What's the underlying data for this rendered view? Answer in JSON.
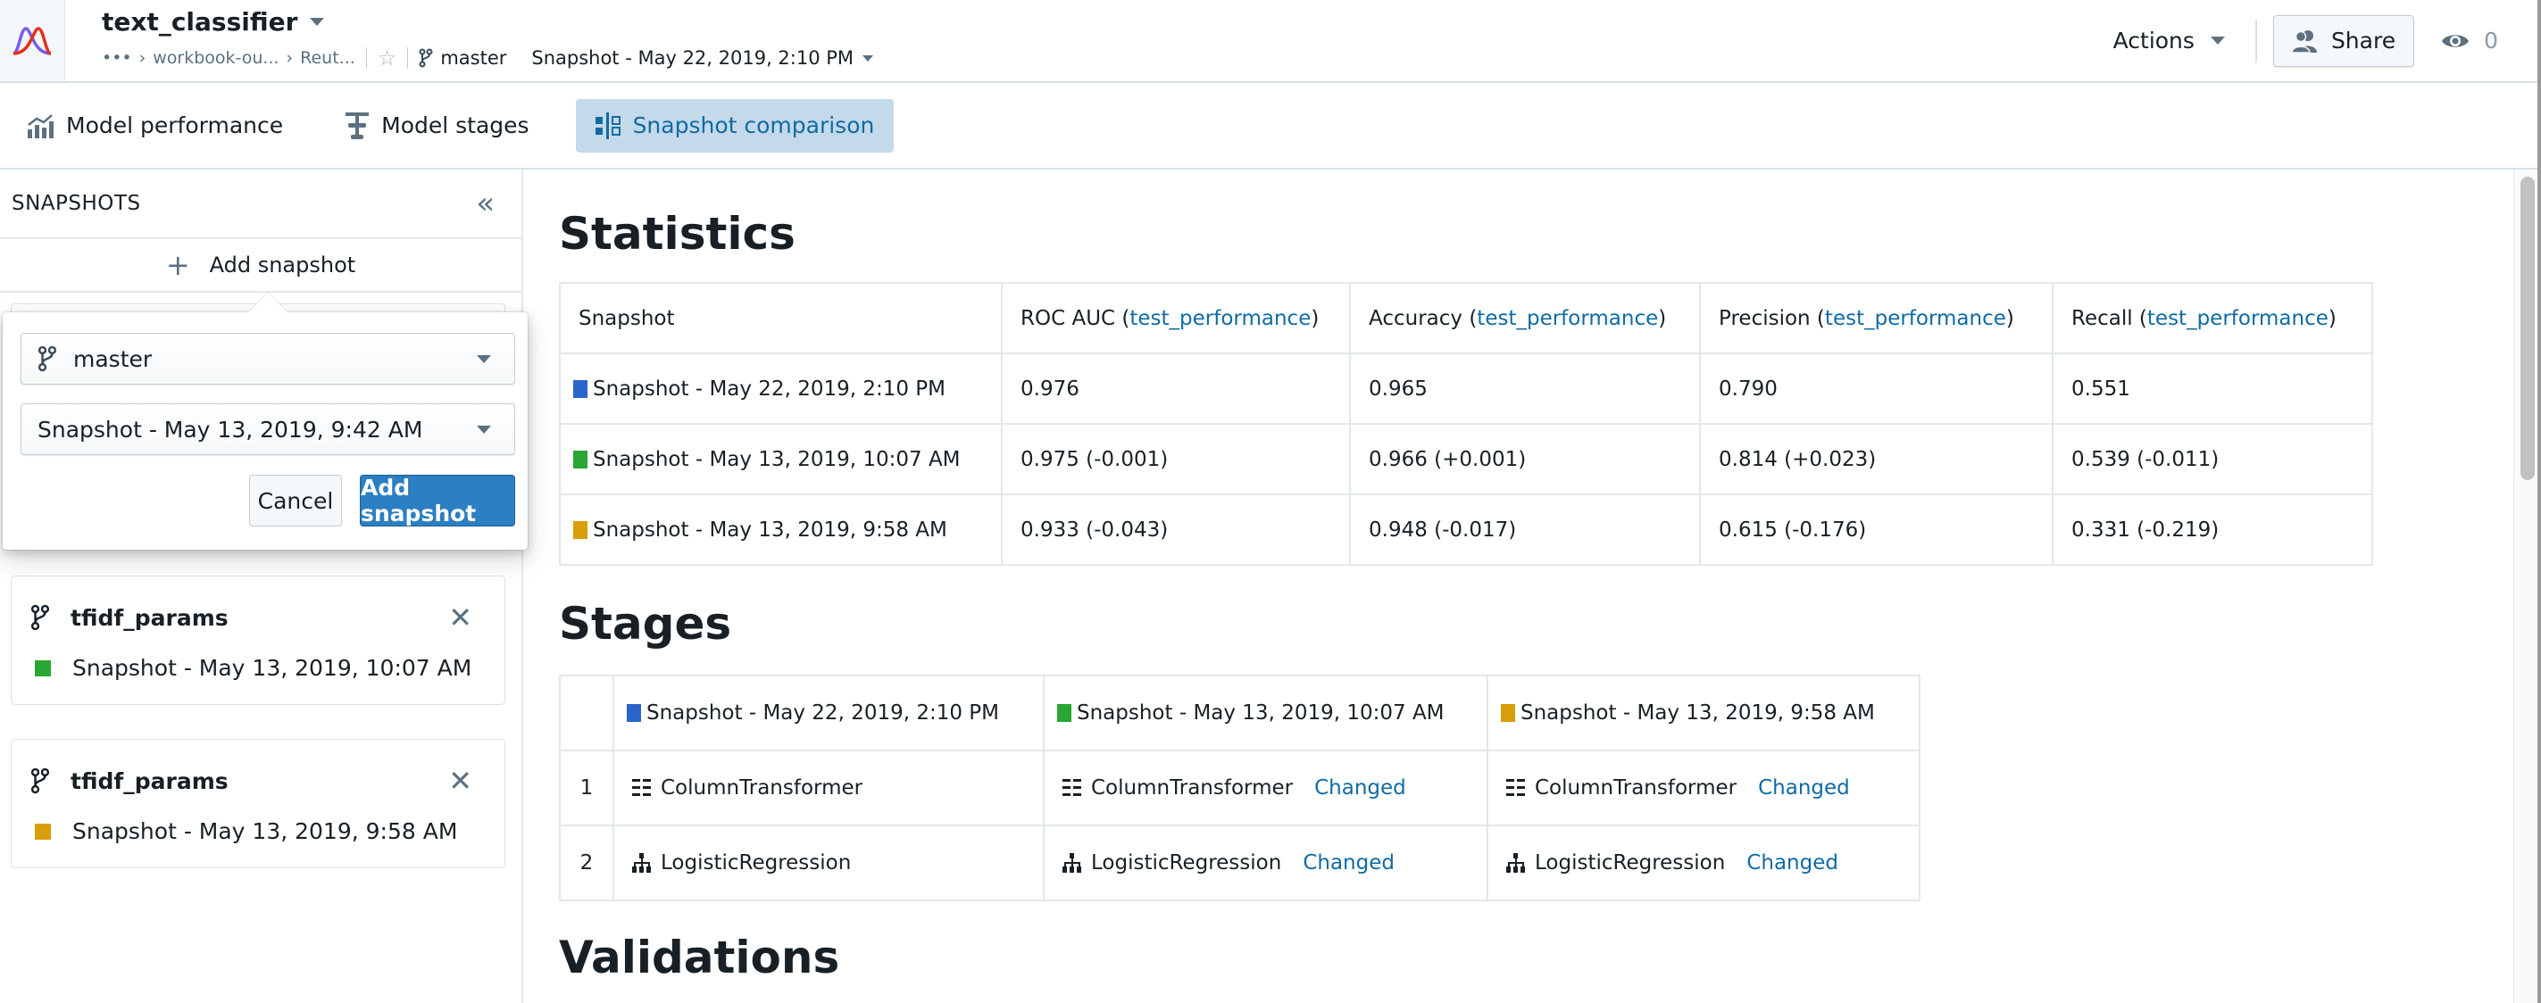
{
  "header": {
    "app_title": "text_classifier",
    "breadcrumbs": [
      "•••",
      "workbook-ou...",
      "Reut..."
    ],
    "branch": "master",
    "snapshot": "Snapshot - May 22, 2019, 2:10 PM",
    "actions_label": "Actions",
    "share_label": "Share",
    "viewer_count": "0"
  },
  "tabs": [
    {
      "label": "Model performance",
      "icon": "chart-icon",
      "active": false
    },
    {
      "label": "Model stages",
      "icon": "stages-icon",
      "active": false
    },
    {
      "label": "Snapshot comparison",
      "icon": "comparison-icon",
      "active": true
    }
  ],
  "sidebar": {
    "title": "SNAPSHOTS",
    "add_label": "Add snapshot",
    "popover": {
      "branch_value": "master",
      "snapshot_value": "Snapshot - May 13, 2019, 9:42 AM",
      "cancel_label": "Cancel",
      "submit_label": "Add snapshot"
    },
    "cards": [
      {
        "branch": "tfidf_params",
        "snapshot": "Snapshot - May 13, 2019, 10:07 AM",
        "color": "#29a634"
      },
      {
        "branch": "tfidf_params",
        "snapshot": "Snapshot - May 13, 2019, 9:58 AM",
        "color": "#d99e0b"
      }
    ]
  },
  "colors": {
    "snap_blue": "#2965cc",
    "snap_green": "#29a634",
    "snap_orange": "#d99e0b",
    "link": "#106ba3",
    "primary": "#2b7fc2"
  },
  "statistics": {
    "title": "Statistics",
    "columns": [
      {
        "name": "Snapshot",
        "source": ""
      },
      {
        "name": "ROC AUC (",
        "source": "test_performance"
      },
      {
        "name": "Accuracy (",
        "source": "test_performance"
      },
      {
        "name": "Precision (",
        "source": "test_performance"
      },
      {
        "name": "Recall (",
        "source": "test_performance"
      }
    ],
    "rows": [
      {
        "snapshot": "Snapshot - May 22, 2019, 2:10 PM",
        "color": "#2965cc",
        "roc_auc": "0.976",
        "accuracy": "0.965",
        "precision": "0.790",
        "recall": "0.551"
      },
      {
        "snapshot": "Snapshot - May 13, 2019, 10:07 AM",
        "color": "#29a634",
        "roc_auc": "0.975 (-0.001)",
        "accuracy": "0.966 (+0.001)",
        "precision": "0.814 (+0.023)",
        "recall": "0.539 (-0.011)"
      },
      {
        "snapshot": "Snapshot - May 13, 2019, 9:58 AM",
        "color": "#d99e0b",
        "roc_auc": "0.933 (-0.043)",
        "accuracy": "0.948 (-0.017)",
        "precision": "0.615 (-0.176)",
        "recall": "0.331 (-0.219)"
      }
    ]
  },
  "stages": {
    "title": "Stages",
    "columns": [
      {
        "snapshot": "Snapshot - May 22, 2019, 2:10 PM",
        "color": "#2965cc"
      },
      {
        "snapshot": "Snapshot - May 13, 2019, 10:07 AM",
        "color": "#29a634"
      },
      {
        "snapshot": "Snapshot - May 13, 2019, 9:58 AM",
        "color": "#d99e0b"
      }
    ],
    "rows": [
      {
        "num": "1",
        "icon": "column-transformer-icon",
        "cells": [
          {
            "name": "ColumnTransformer",
            "badge": ""
          },
          {
            "name": "ColumnTransformer",
            "badge": "Changed"
          },
          {
            "name": "ColumnTransformer",
            "badge": "Changed"
          }
        ]
      },
      {
        "num": "2",
        "icon": "hierarchy-icon",
        "cells": [
          {
            "name": "LogisticRegression",
            "badge": ""
          },
          {
            "name": "LogisticRegression",
            "badge": "Changed"
          },
          {
            "name": "LogisticRegression",
            "badge": "Changed"
          }
        ]
      }
    ]
  },
  "validations": {
    "title": "Validations"
  }
}
